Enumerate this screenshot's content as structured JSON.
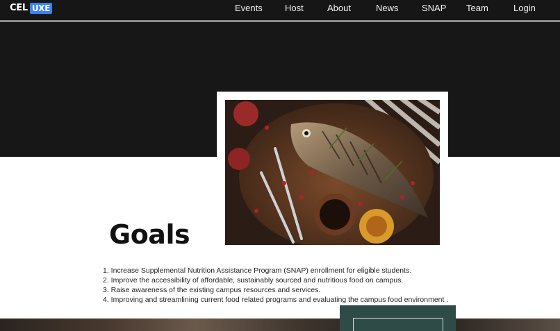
{
  "header": {
    "logo_left": "CEL",
    "logo_right": "UXE",
    "nav": [
      "Events",
      "Host",
      "About",
      "News",
      "SNAP",
      "Team",
      "Login"
    ]
  },
  "goals": {
    "title": "Goals",
    "items": [
      "1. Increase Supplemental Nutrition Assistance Program (SNAP) enrollment for eligible students.",
      "2. Improve the accessibility of affordable, sustainably sourced and nutritious food on campus.",
      "3. Raise awareness of the existing campus resources and services.",
      "4. Improving and streamlining current food related programs and evaluating the campus food environment ."
    ]
  },
  "colors": {
    "header_bg": "#161616",
    "hero_bg": "#171717",
    "logo_accent": "#3b82f6",
    "card_bg": "#2f4b47"
  }
}
